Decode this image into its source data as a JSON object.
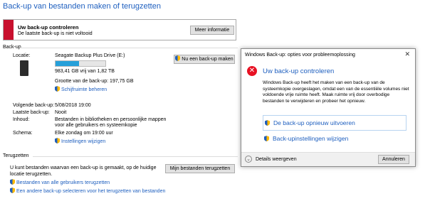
{
  "page_title": "Back-up van bestanden maken of terugzetten",
  "alert": {
    "heading": "Uw back-up controleren",
    "message": "De laatste back-up is niet voltooid",
    "button": "Meer informatie"
  },
  "backup": {
    "section_title": "Back-up",
    "location_label": "Locatie:",
    "drive_name": "Seagate Backup Plus Drive (E:)",
    "progress_fraction": 0.47,
    "free_space": "983,41 GB vrij van 1,82 TB",
    "backup_size": "Grootte van de back-up: 197,75 GB",
    "manage_space": "Schijfruimte beheren",
    "backup_now_button": "Nu een back-up maken",
    "next_label": "Volgende back-up:",
    "next_value": "5/08/2018 19:00",
    "last_label": "Laatste back-up:",
    "last_value": "Nooit",
    "contents_label": "Inhoud:",
    "contents_value_1": "Bestanden in bibliotheken en persoonlijke mappen",
    "contents_value_2": "voor alle gebruikers en systeemkopie",
    "schedule_label": "Schema:",
    "schedule_value": "Elke zondag om 19:00 uur",
    "change_settings": "Instellingen wijzigen"
  },
  "restore": {
    "section_title": "Terugzetten",
    "text_1": "U kunt bestanden waarvan een back-up is gemaakt, op de huidige",
    "text_2": "locatie terugzetten.",
    "restore_button": "Mijn bestanden terugzetten",
    "link_all_users": "Bestanden van alle gebruikers terugzetten",
    "link_other_backup": "Een andere back-up selecteren voor het terugzetten van bestanden"
  },
  "dialog": {
    "caption": "Windows Back-up: opties voor probleemoplossing",
    "close": "✕",
    "main_title": "Uw back-up controleren",
    "body": "Windows Back-up heeft het maken van een back-up van de systeemkopie overgeslagen, omdat een van de essentiële volumes niet voldoende vrije ruimte heeft. Maak ruimte vrij door overbodige bestanden te verwijderen en probeer het opnieuw.",
    "cmd_retry": "De back-up opnieuw uitvoeren",
    "cmd_settings": "Back-upinstellingen wijzigen",
    "details": "Details weergeven",
    "cancel": "Annuleren",
    "error_icon": "✕"
  },
  "colors": {
    "accent": "#1e5fbf",
    "error": "#c8102e",
    "progress": "#26a0da"
  },
  "icons": [
    "error-icon",
    "shield-icon",
    "drive-icon",
    "chevron-down-icon",
    "close-icon"
  ]
}
